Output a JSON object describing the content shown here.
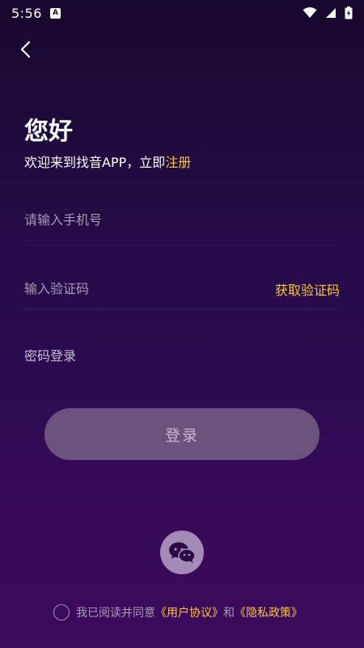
{
  "status_bar": {
    "time": "5:56",
    "notification_icon": "a-icon"
  },
  "header": {
    "back_icon": "chevron-left-icon"
  },
  "greeting": "您好",
  "welcome": {
    "text": "欢迎来到找音APP，立即",
    "register_link": "注册"
  },
  "phone_field": {
    "placeholder": "请输入手机号",
    "value": ""
  },
  "code_field": {
    "placeholder": "输入验证码",
    "value": "",
    "get_code_label": "获取验证码"
  },
  "password_login_label": "密码登录",
  "login_button_label": "登录",
  "wechat_icon": "wechat-icon",
  "agreement": {
    "text": "我已阅读并同意",
    "user_agreement": "《用户协议》",
    "conjunction": "和",
    "privacy_policy": "《隐私政策》",
    "checked": false
  },
  "colors": {
    "accent": "#f6c53d",
    "background_top": "#17082e",
    "background_bottom": "#3e0a5c",
    "button": "#6b537d"
  }
}
